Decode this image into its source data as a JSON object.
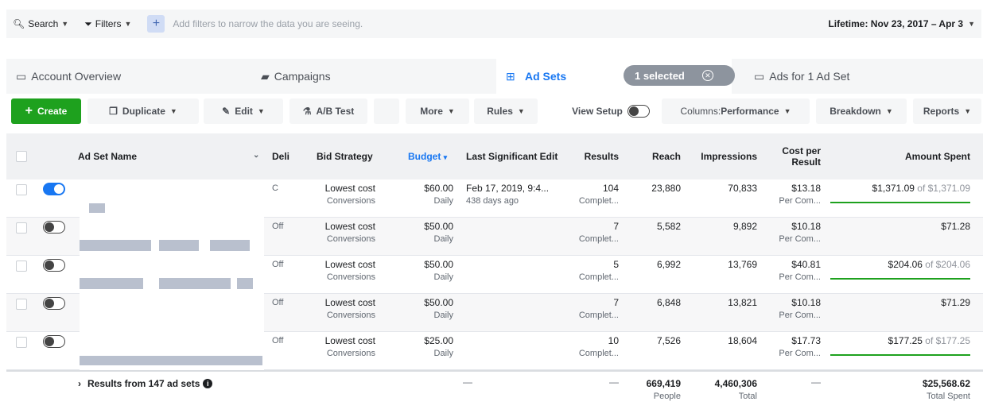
{
  "filterbar": {
    "search_label": "Search",
    "filters_label": "Filters",
    "hint": "Add filters to narrow the data you are seeing.",
    "date_range": "Lifetime: Nov 23, 2017 – Apr 3"
  },
  "tabs": {
    "account_overview": "Account Overview",
    "campaigns": "Campaigns",
    "ad_sets": "Ad Sets",
    "selected": "1 selected",
    "ads": "Ads for 1 Ad Set"
  },
  "toolbar": {
    "create": "Create",
    "duplicate": "Duplicate",
    "edit": "Edit",
    "ab_test": "A/B Test",
    "more": "More",
    "rules": "Rules",
    "view_setup": "View Setup",
    "columns_prefix": "Columns: ",
    "columns_value": "Performance",
    "breakdown": "Breakdown",
    "reports": "Reports"
  },
  "table": {
    "headers": {
      "name": "Ad Set Name",
      "delivery": "Deli",
      "bid": "Bid Strategy",
      "budget": "Budget",
      "last_edit": "Last Significant Edit",
      "results": "Results",
      "reach": "Reach",
      "impressions": "Impressions",
      "cpr": "Cost per Result",
      "spent": "Amount Spent"
    },
    "rows": [
      {
        "delivery": "C",
        "bid": "Lowest cost",
        "bid_sub": "Conversions",
        "budget": "$60.00",
        "budget_sub": "Daily",
        "edit": "Feb 17, 2019, 9:4...",
        "edit_sub": "438 days ago",
        "results": "104",
        "results_sub": "Complet...",
        "reach": "23,880",
        "impressions": "70,833",
        "cpr": "$13.18",
        "cpr_sub": "Per Com...",
        "spent": "$1,371.09",
        "spent_of": "of $1,371.09",
        "toggle": "on"
      },
      {
        "delivery": "Off",
        "bid": "Lowest cost",
        "bid_sub": "Conversions",
        "budget": "$50.00",
        "budget_sub": "Daily",
        "edit": "",
        "edit_sub": "",
        "results": "7",
        "results_sub": "Complet...",
        "reach": "5,582",
        "impressions": "9,892",
        "cpr": "$10.18",
        "cpr_sub": "Per Com...",
        "spent": "$71.28",
        "spent_of": "",
        "toggle": "off"
      },
      {
        "delivery": "Off",
        "bid": "Lowest cost",
        "bid_sub": "Conversions",
        "budget": "$50.00",
        "budget_sub": "Daily",
        "edit": "",
        "edit_sub": "",
        "results": "5",
        "results_sub": "Complet...",
        "reach": "6,992",
        "impressions": "13,769",
        "cpr": "$40.81",
        "cpr_sub": "Per Com...",
        "spent": "$204.06",
        "spent_of": "of $204.06",
        "toggle": "off"
      },
      {
        "delivery": "Off",
        "bid": "Lowest cost",
        "bid_sub": "Conversions",
        "budget": "$50.00",
        "budget_sub": "Daily",
        "edit": "",
        "edit_sub": "",
        "results": "7",
        "results_sub": "Complet...",
        "reach": "6,848",
        "impressions": "13,821",
        "cpr": "$10.18",
        "cpr_sub": "Per Com...",
        "spent": "$71.29",
        "spent_of": "",
        "toggle": "off"
      },
      {
        "delivery": "Off",
        "bid": "Lowest cost",
        "bid_sub": "Conversions",
        "budget": "$25.00",
        "budget_sub": "Daily",
        "edit": "",
        "edit_sub": "",
        "results": "10",
        "results_sub": "Complet...",
        "reach": "7,526",
        "impressions": "18,604",
        "cpr": "$17.73",
        "cpr_sub": "Per Com...",
        "spent": "$177.25",
        "spent_of": "of $177.25",
        "toggle": "off"
      }
    ],
    "footer": {
      "label": "Results from 147 ad sets",
      "edit": "—",
      "results": "—",
      "reach": "669,419",
      "reach_sub": "People",
      "impressions": "4,460,306",
      "impressions_sub": "Total",
      "cpr": "—",
      "spent": "$25,568.62",
      "spent_sub": "Total Spent"
    }
  },
  "colors": {
    "accent": "#1877f2",
    "create": "#1ea11e",
    "progress": "#1ea11e"
  }
}
